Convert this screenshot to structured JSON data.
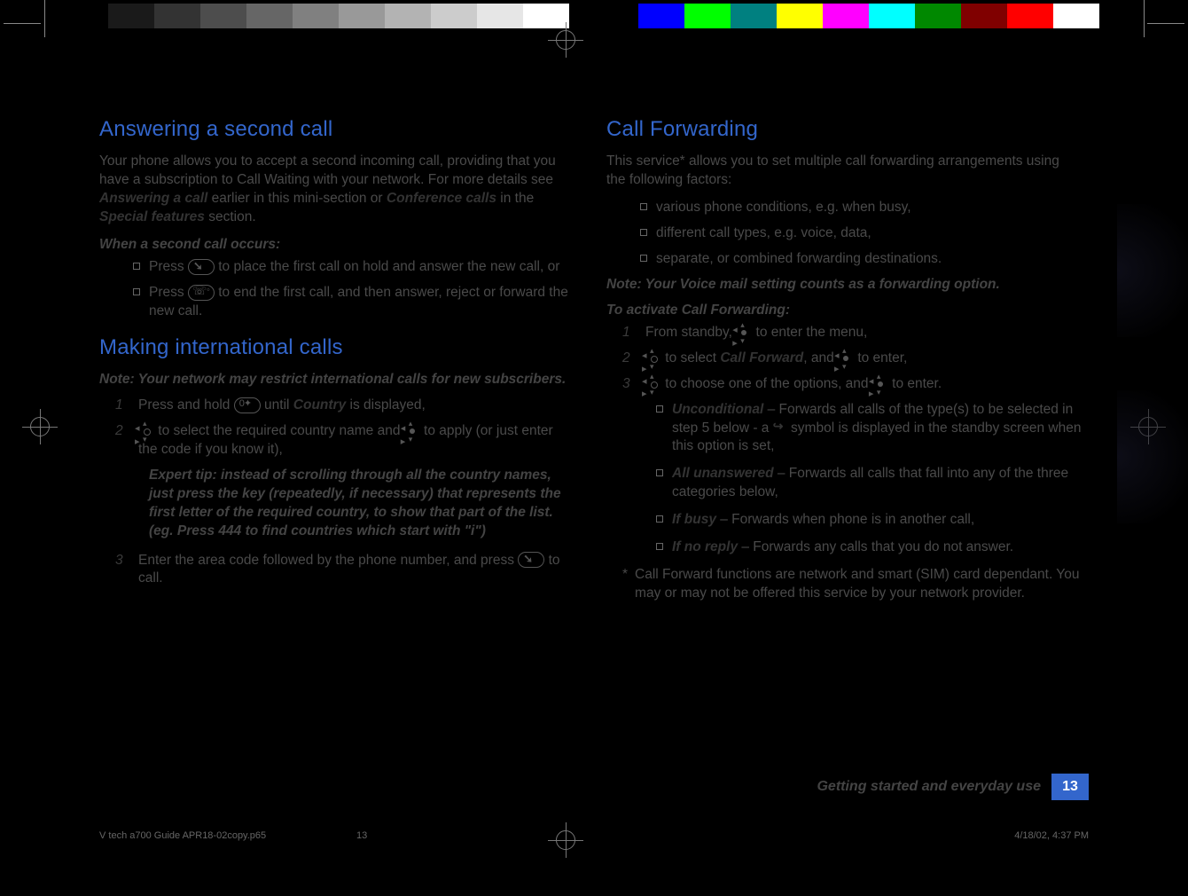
{
  "left": {
    "h1": "Answering a second call",
    "intro_a": "Your phone allows you to accept a second incoming call, providing that you have a subscription to Call Waiting with your network. For more details see ",
    "intro_b": "Answering a call",
    "intro_c": " earlier in this mini-section or ",
    "intro_d": "Conference calls",
    "intro_e": " in the ",
    "intro_f": "Special features",
    "intro_g": " section.",
    "sub1": "When a second call occurs:",
    "b1a": "Press ",
    "b1b": " to place the first call on hold and answer the new call, or",
    "b2a": "Press ",
    "b2b": " to end the first call, and then answer, reject or forward the new call.",
    "h2": "Making international calls",
    "note": "Note: Your network may restrict international calls for new subscribers.",
    "s1a": "Press and hold ",
    "s1b": " until ",
    "s1c": "Country",
    "s1d": " is displayed,",
    "s2a": " to select the required country name and ",
    "s2b": " to apply (or just enter the code if you know it),",
    "tip": "Expert tip: instead of scrolling through all the country names, just press the key (repeatedly, if necessary) that represents the first letter of the required country, to show that part of the list.(eg. Press 444 to find countries which start with \"i\")",
    "s3a": "Enter the area code followed by the phone number, and press ",
    "s3b": " to call."
  },
  "right": {
    "h1": "Call  Forwarding",
    "intro": "This service* allows you to set multiple call forwarding arrangements using the following factors:",
    "f1": "various phone conditions, e.g. when busy,",
    "f2": "different call types, e.g. voice, data,",
    "f3": "separate, or combined forwarding destinations.",
    "note": "Note: Your Voice mail setting counts as a forwarding option.",
    "sub": "To activate Call Forwarding:",
    "s1a": "From standby, ",
    "s1b": " to enter the menu,",
    "s2a": " to select ",
    "s2b": "Call Forward",
    "s2c": ", and ",
    "s2d": " to enter,",
    "s3a": " to choose one of the options, and ",
    "s3b": " to enter.",
    "o1a": "Unconditional",
    "o1b": " – Forwards all calls of the type(s) to be selected in step 5 below - a ",
    "o1c": " symbol is displayed in the standby screen when this option is set,",
    "o2a": "All unanswered",
    "o2b": " – Forwards all calls that fall into any of the three categories below,",
    "o3a": "If busy",
    "o3b": " – Forwards when phone is in another call,",
    "o4a": "If no reply",
    "o4b": " – Forwards any calls that you do not answer.",
    "star": "*",
    "foot": "Call Forward functions are network and smart (SIM) card dependant. You may or may not be offered this service by your network provider."
  },
  "footer": {
    "label": "Getting started and everyday use",
    "page": "13"
  },
  "meta": {
    "file": "V tech a700 Guide APR18-02copy.p65",
    "pg": "13",
    "stamp": "4/18/02, 4:37 PM"
  },
  "nums": {
    "n1": "1",
    "n2": "2",
    "n3": "3"
  }
}
